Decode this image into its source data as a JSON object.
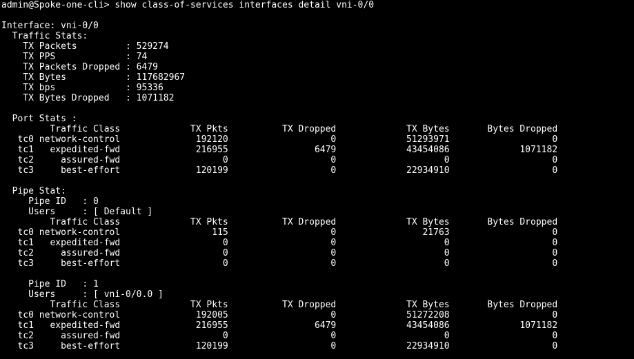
{
  "terminal": {
    "prompt": "admin@Spoke-one-cli> show class-of-services interfaces detail vni-0/0",
    "interface_line": "Interface: vni-0/0",
    "traffic_stats_header": "  Traffic Stats:",
    "traffic_stats": [
      "    TX Packets         : 529274",
      "    TX PPS             : 74",
      "    TX Packets Dropped : 6479",
      "    TX Bytes           : 117682967",
      "    TX bps             : 95336",
      "    TX Bytes Dropped   : 1071182"
    ],
    "port_stats_header": "  Port Stats :",
    "port_stats_columns": "         Traffic Class             TX Pkts          TX Dropped             TX Bytes       Bytes Dropped",
    "port_stats_rows": [
      "   tc0 network-control              192120                   0             51293971                   0",
      "   tc1   expedited-fwd              216955                6479             43454086             1071182",
      "   tc2     assured-fwd                   0                   0                    0                   0",
      "   tc3     best-effort              120199                   0             22934910                   0"
    ],
    "pipe_stat_header": "  Pipe Stat:",
    "pipes": [
      {
        "pipe_id": "     Pipe ID   : 0",
        "users": "     Users     : [ Default ]",
        "columns": "         Traffic Class             TX Pkts          TX Dropped             TX Bytes       Bytes Dropped",
        "rows": [
          "   tc0 network-control                 115                   0                21763                   0",
          "   tc1   expedited-fwd                   0                   0                    0                   0",
          "   tc2     assured-fwd                   0                   0                    0                   0",
          "   tc3     best-effort                   0                   0                    0                   0"
        ]
      },
      {
        "pipe_id": "     Pipe ID   : 1",
        "users": "     Users     : [ vni-0/0.0 ]",
        "columns": "         Traffic Class             TX Pkts          TX Dropped             TX Bytes       Bytes Dropped",
        "rows": [
          "   tc0 network-control              192005                   0             51272208                   0",
          "   tc1   expedited-fwd              216955                6479             43454086             1071182",
          "   tc2     assured-fwd                   0                   0                    0                   0",
          "   tc3     best-effort              120199                   0             22934910                   0"
        ]
      }
    ]
  }
}
